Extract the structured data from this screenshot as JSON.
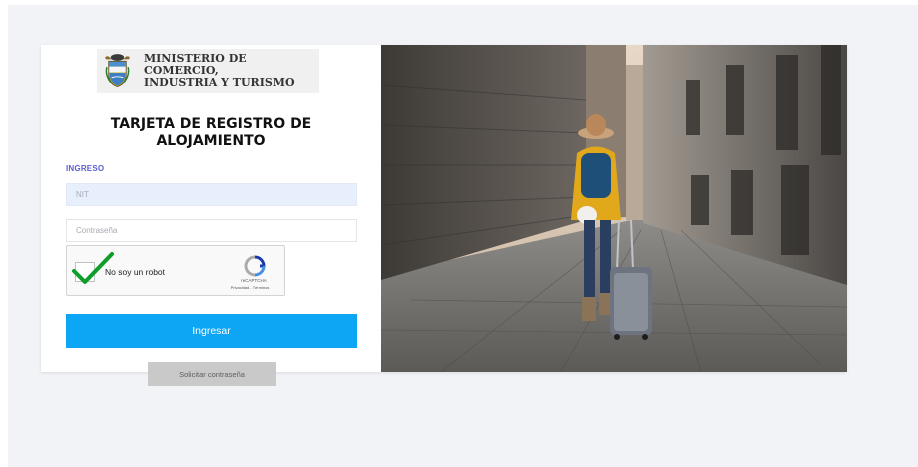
{
  "header": {
    "ministry_line1": "MINISTERIO DE COMERCIO,",
    "ministry_line2": "INDUSTRIA Y TURISMO",
    "coat_of_arms_icon": "colombia-coat-of-arms-icon"
  },
  "form": {
    "title_line1": "TARJETA DE REGISTRO DE",
    "title_line2": "ALOJAMIENTO",
    "section_label": "INGRESO",
    "nit_placeholder": "NIT",
    "password_placeholder": "Contraseña",
    "submit_label": "Ingresar",
    "request_password_label": "Solicitar contraseña"
  },
  "recaptcha": {
    "label": "No soy un robot",
    "brand": "reCAPTCHA",
    "links": "Privacidad - Términos",
    "checked": true
  },
  "colors": {
    "accent": "#0da6f5",
    "section_label": "#5a5fd0",
    "background": "#f1f3f7"
  }
}
